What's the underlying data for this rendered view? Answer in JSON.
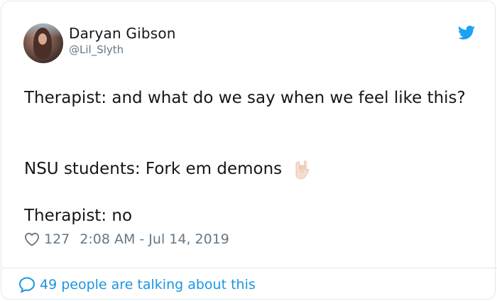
{
  "author": {
    "name": "Daryan Gibson",
    "handle": "@Lil_Slyth"
  },
  "tweet": {
    "line1": "Therapist: and what do we say when we feel like this?",
    "line2": "NSU students: Fork em demons",
    "line3": "Therapist: no"
  },
  "meta": {
    "likes": "127",
    "timestamp": "2:08 AM - Jul 14, 2019"
  },
  "footer": {
    "talking": "49 people are talking about this"
  },
  "icons": {
    "brand": "twitter-bird-icon",
    "like": "heart-icon",
    "reply": "speech-bubble-icon",
    "emoji": "horns-hand-emoji"
  },
  "colors": {
    "twitter_blue": "#1da1f2",
    "link_blue": "#1b95e0",
    "muted": "#657786",
    "text": "#14171a",
    "border": "#e1e8ed"
  }
}
